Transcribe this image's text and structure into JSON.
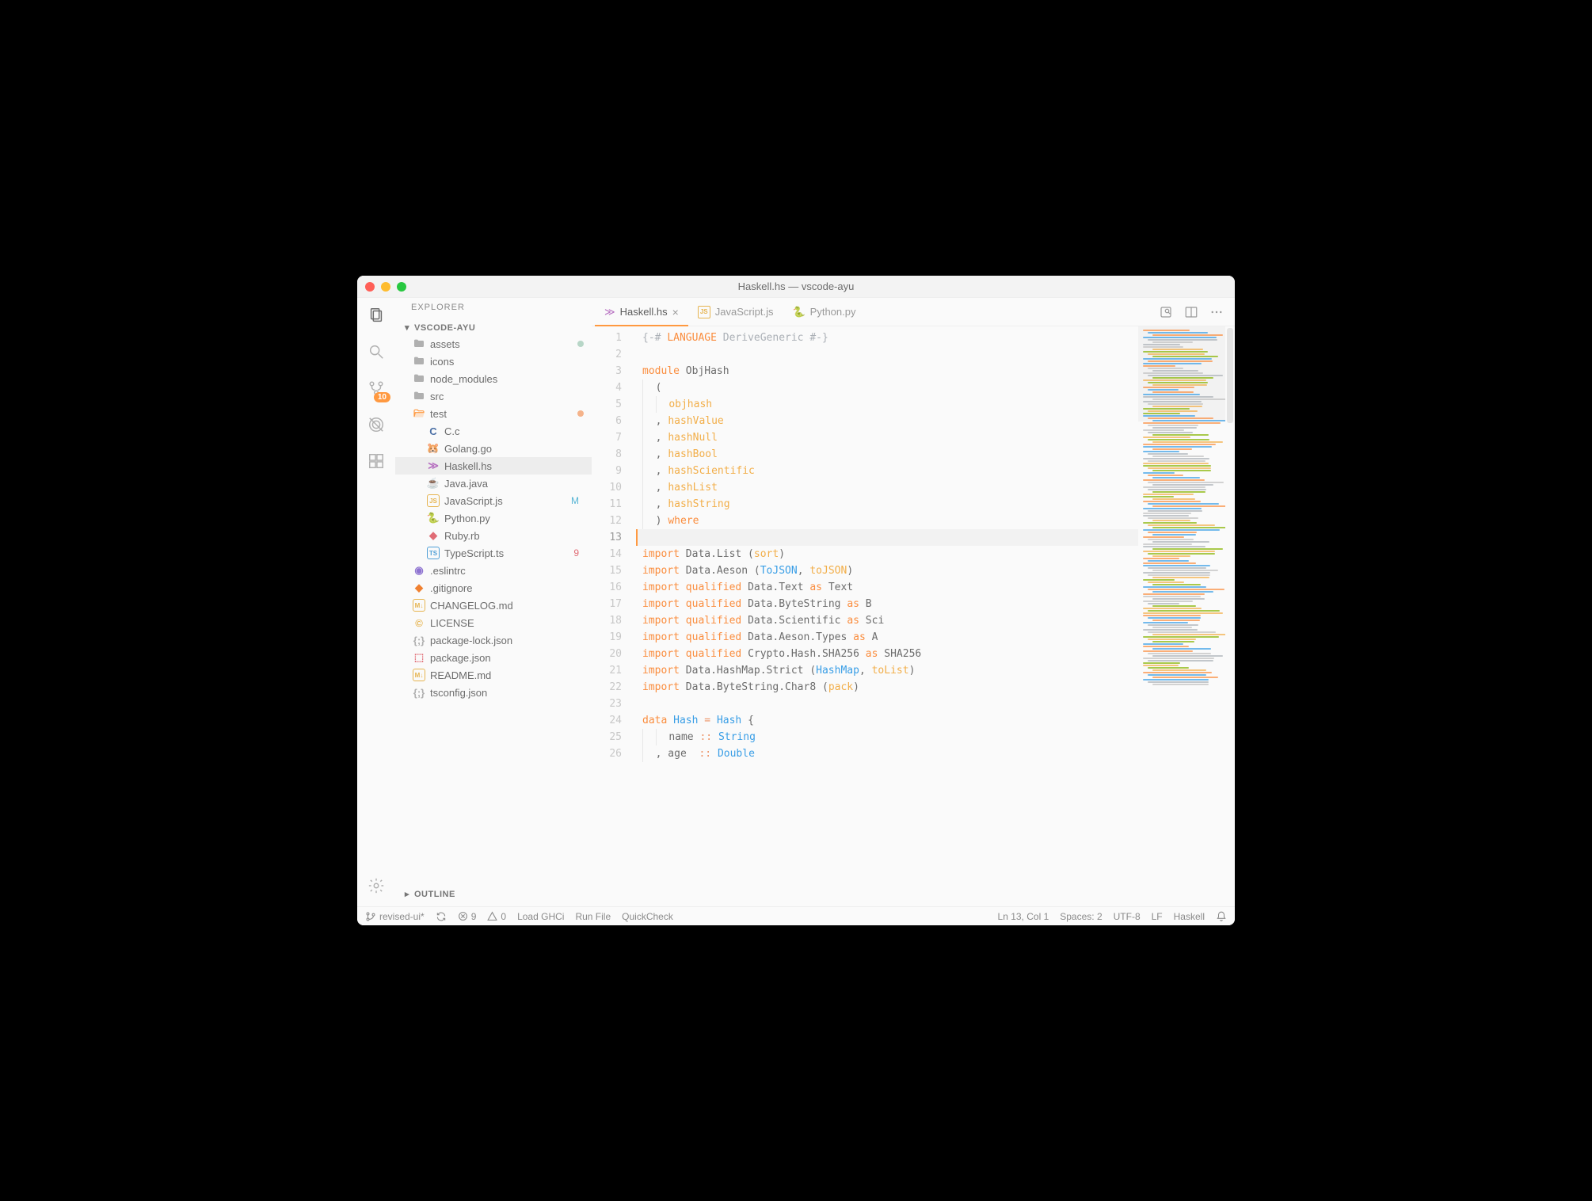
{
  "window": {
    "title": "Haskell.hs — vscode-ayu"
  },
  "activitybar": {
    "items": [
      {
        "name": "files-icon",
        "active": true
      },
      {
        "name": "search-icon"
      },
      {
        "name": "source-control-icon",
        "badge": "10"
      },
      {
        "name": "debug-icon"
      },
      {
        "name": "extensions-icon"
      }
    ],
    "bottom": {
      "name": "gear-icon"
    }
  },
  "sidebar": {
    "title": "EXPLORER",
    "workspace": "VSCODE-AYU",
    "tree": [
      {
        "kind": "folder",
        "label": "assets",
        "indent": 0,
        "status": "untracked",
        "status_color": "#b7d6c7"
      },
      {
        "kind": "folder",
        "label": "icons",
        "indent": 0
      },
      {
        "kind": "folder",
        "label": "node_modules",
        "indent": 0
      },
      {
        "kind": "folder",
        "label": "src",
        "indent": 0
      },
      {
        "kind": "folder-open",
        "label": "test",
        "indent": 0,
        "status": "modified",
        "status_color": "#f5b38a"
      },
      {
        "kind": "file",
        "label": "C.c",
        "indent": 1,
        "icon_text": "C",
        "icon_bg": "",
        "icon_color": "#4a6fa5"
      },
      {
        "kind": "file",
        "label": "Golang.go",
        "indent": 1,
        "icon_text": "🐹",
        "icon_color": "#75cde0"
      },
      {
        "kind": "file",
        "label": "Haskell.hs",
        "indent": 1,
        "active": true,
        "icon_text": "≫",
        "icon_color": "#b66fc0"
      },
      {
        "kind": "file",
        "label": "Java.java",
        "indent": 1,
        "icon_text": "☕",
        "icon_color": "#d17742"
      },
      {
        "kind": "file",
        "label": "JavaScript.js",
        "indent": 1,
        "icon_text": "JS",
        "icon_color": "#e6b450",
        "status": "M",
        "status_color": "#55b4d4"
      },
      {
        "kind": "file",
        "label": "Python.py",
        "indent": 1,
        "icon_text": "🐍",
        "icon_color": "#d6b340"
      },
      {
        "kind": "file",
        "label": "Ruby.rb",
        "indent": 1,
        "icon_text": "◆",
        "icon_color": "#e06c75"
      },
      {
        "kind": "file",
        "label": "TypeScript.ts",
        "indent": 1,
        "icon_text": "TS",
        "icon_color": "#4f9fd6",
        "status": "9",
        "status_color": "#e06c75"
      },
      {
        "kind": "file",
        "label": ".eslintrc",
        "indent": 0,
        "icon_text": "◉",
        "icon_color": "#8f74d1"
      },
      {
        "kind": "file",
        "label": ".gitignore",
        "indent": 0,
        "icon_text": "◆",
        "icon_color": "#f08030"
      },
      {
        "kind": "file",
        "label": "CHANGELOG.md",
        "indent": 0,
        "icon_text": "M↓",
        "icon_color": "#e6b450"
      },
      {
        "kind": "file",
        "label": "LICENSE",
        "indent": 0,
        "icon_text": "©",
        "icon_color": "#e6b450"
      },
      {
        "kind": "file",
        "label": "package-lock.json",
        "indent": 0,
        "icon_text": "{;}",
        "icon_color": "#b0b0b0"
      },
      {
        "kind": "file",
        "label": "package.json",
        "indent": 0,
        "icon_text": "⬚",
        "icon_color": "#e06c75"
      },
      {
        "kind": "file",
        "label": "README.md",
        "indent": 0,
        "icon_text": "M↓",
        "icon_color": "#e6b450"
      },
      {
        "kind": "file",
        "label": "tsconfig.json",
        "indent": 0,
        "icon_text": "{;}",
        "icon_color": "#b0b0b0"
      }
    ],
    "outline_label": "OUTLINE"
  },
  "tabs": {
    "items": [
      {
        "label": "Haskell.hs",
        "icon": "≫",
        "icon_color": "#b66fc0",
        "active": true,
        "closeable": true
      },
      {
        "label": "JavaScript.js",
        "icon": "JS",
        "icon_color": "#e6b450"
      },
      {
        "label": "Python.py",
        "icon": "🐍",
        "icon_color": "#d6b340"
      }
    ]
  },
  "editor": {
    "cursor_line": 13,
    "lines": [
      [
        {
          "t": "{-# ",
          "c": "comment"
        },
        {
          "t": "LANGUAGE",
          "c": "pragma"
        },
        {
          "t": " DeriveGeneric #-}",
          "c": "comment"
        }
      ],
      [],
      [
        {
          "t": "module",
          "c": "kw"
        },
        {
          "t": " ObjHash",
          "c": "punc"
        }
      ],
      [
        {
          "g": 1
        },
        {
          "t": "(",
          "c": "punc"
        }
      ],
      [
        {
          "g": 2
        },
        {
          "t": "objhash",
          "c": "func"
        }
      ],
      [
        {
          "g": 1
        },
        {
          "t": ", ",
          "c": "punc"
        },
        {
          "t": "hashValue",
          "c": "func"
        }
      ],
      [
        {
          "g": 1
        },
        {
          "t": ", ",
          "c": "punc"
        },
        {
          "t": "hashNull",
          "c": "func"
        }
      ],
      [
        {
          "g": 1
        },
        {
          "t": ", ",
          "c": "punc"
        },
        {
          "t": "hashBool",
          "c": "func"
        }
      ],
      [
        {
          "g": 1
        },
        {
          "t": ", ",
          "c": "punc"
        },
        {
          "t": "hashScientific",
          "c": "func"
        }
      ],
      [
        {
          "g": 1
        },
        {
          "t": ", ",
          "c": "punc"
        },
        {
          "t": "hashList",
          "c": "func"
        }
      ],
      [
        {
          "g": 1
        },
        {
          "t": ", ",
          "c": "punc"
        },
        {
          "t": "hashString",
          "c": "func"
        }
      ],
      [
        {
          "g": 1
        },
        {
          "t": ") ",
          "c": "punc"
        },
        {
          "t": "where",
          "c": "kw"
        }
      ],
      [],
      [
        {
          "t": "import",
          "c": "kw"
        },
        {
          "t": " Data.List (",
          "c": "punc"
        },
        {
          "t": "sort",
          "c": "func"
        },
        {
          "t": ")",
          "c": "punc"
        }
      ],
      [
        {
          "t": "import",
          "c": "kw"
        },
        {
          "t": " Data.Aeson (",
          "c": "punc"
        },
        {
          "t": "ToJSON",
          "c": "type"
        },
        {
          "t": ", ",
          "c": "punc"
        },
        {
          "t": "toJSON",
          "c": "func"
        },
        {
          "t": ")",
          "c": "punc"
        }
      ],
      [
        {
          "t": "import",
          "c": "kw"
        },
        {
          "t": " ",
          "c": "punc"
        },
        {
          "t": "qualified",
          "c": "kw"
        },
        {
          "t": " Data.Text ",
          "c": "punc"
        },
        {
          "t": "as",
          "c": "kw"
        },
        {
          "t": " Text",
          "c": "punc"
        }
      ],
      [
        {
          "t": "import",
          "c": "kw"
        },
        {
          "t": " ",
          "c": "punc"
        },
        {
          "t": "qualified",
          "c": "kw"
        },
        {
          "t": " Data.ByteString ",
          "c": "punc"
        },
        {
          "t": "as",
          "c": "kw"
        },
        {
          "t": " B",
          "c": "punc"
        }
      ],
      [
        {
          "t": "import",
          "c": "kw"
        },
        {
          "t": " ",
          "c": "punc"
        },
        {
          "t": "qualified",
          "c": "kw"
        },
        {
          "t": " Data.Scientific ",
          "c": "punc"
        },
        {
          "t": "as",
          "c": "kw"
        },
        {
          "t": " Sci",
          "c": "punc"
        }
      ],
      [
        {
          "t": "import",
          "c": "kw"
        },
        {
          "t": " ",
          "c": "punc"
        },
        {
          "t": "qualified",
          "c": "kw"
        },
        {
          "t": " Data.Aeson.Types ",
          "c": "punc"
        },
        {
          "t": "as",
          "c": "kw"
        },
        {
          "t": " A",
          "c": "punc"
        }
      ],
      [
        {
          "t": "import",
          "c": "kw"
        },
        {
          "t": " ",
          "c": "punc"
        },
        {
          "t": "qualified",
          "c": "kw"
        },
        {
          "t": " Crypto.Hash.SHA256 ",
          "c": "punc"
        },
        {
          "t": "as",
          "c": "kw"
        },
        {
          "t": " SHA256",
          "c": "punc"
        }
      ],
      [
        {
          "t": "import",
          "c": "kw"
        },
        {
          "t": " Data.HashMap.Strict (",
          "c": "punc"
        },
        {
          "t": "HashMap",
          "c": "type"
        },
        {
          "t": ", ",
          "c": "punc"
        },
        {
          "t": "toList",
          "c": "func"
        },
        {
          "t": ")",
          "c": "punc"
        }
      ],
      [
        {
          "t": "import",
          "c": "kw"
        },
        {
          "t": " Data.ByteString.Char8 (",
          "c": "punc"
        },
        {
          "t": "pack",
          "c": "func"
        },
        {
          "t": ")",
          "c": "punc"
        }
      ],
      [],
      [
        {
          "t": "data",
          "c": "kw"
        },
        {
          "t": " ",
          "c": "punc"
        },
        {
          "t": "Hash",
          "c": "type"
        },
        {
          "t": " = ",
          "c": "op"
        },
        {
          "t": "Hash",
          "c": "type"
        },
        {
          "t": " {",
          "c": "punc"
        }
      ],
      [
        {
          "g": 2
        },
        {
          "t": "name ",
          "c": "punc"
        },
        {
          "t": "::",
          "c": "op"
        },
        {
          "t": " ",
          "c": "punc"
        },
        {
          "t": "String",
          "c": "type"
        }
      ],
      [
        {
          "g": 1
        },
        {
          "t": ", age  ",
          "c": "punc"
        },
        {
          "t": "::",
          "c": "op"
        },
        {
          "t": " ",
          "c": "punc"
        },
        {
          "t": "Double",
          "c": "type"
        }
      ]
    ]
  },
  "statusbar": {
    "branch": "revised-ui*",
    "errors": "9",
    "warnings": "0",
    "actions": [
      "Load GHCi",
      "Run File",
      "QuickCheck"
    ],
    "position": "Ln 13, Col 1",
    "spaces": "Spaces: 2",
    "encoding": "UTF-8",
    "eol": "LF",
    "language": "Haskell"
  }
}
